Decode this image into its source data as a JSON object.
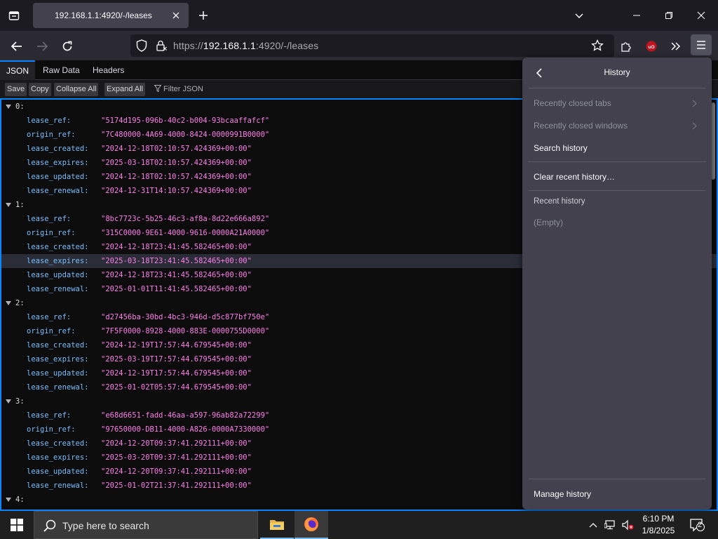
{
  "browser": {
    "tab_title": "192.168.1.1:4920/-/leases",
    "url_scheme": "https://",
    "url_host": "192.168.1.1",
    "url_rest": ":4920/-/leases"
  },
  "viewer": {
    "tabs": [
      "JSON",
      "Raw Data",
      "Headers"
    ],
    "toolbar": {
      "save": "Save",
      "copy": "Copy",
      "collapse_all": "Collapse All",
      "expand_all": "Expand All",
      "filter": "Filter JSON"
    },
    "entries": [
      {
        "index": "0:",
        "lease_ref": "\"5174d195-096b-40c2-b004-93bcaaffafcf\"",
        "origin_ref": "\"7C480000-4A69-4000-8424-0000991B0000\"",
        "lease_created": "\"2024-12-18T02:10:57.424369+00:00\"",
        "lease_expires": "\"2025-03-18T02:10:57.424369+00:00\"",
        "lease_updated": "\"2024-12-18T02:10:57.424369+00:00\"",
        "lease_renewal": "\"2024-12-31T14:10:57.424369+00:00\""
      },
      {
        "index": "1:",
        "lease_ref": "\"8bc7723c-5b25-46c3-af8a-8d22e666a892\"",
        "origin_ref": "\"315C0000-9E61-4000-9616-0000A21A0000\"",
        "lease_created": "\"2024-12-18T23:41:45.582465+00:00\"",
        "lease_expires": "\"2025-03-18T23:41:45.582465+00:00\"",
        "lease_updated": "\"2024-12-18T23:41:45.582465+00:00\"",
        "lease_renewal": "\"2025-01-01T11:41:45.582465+00:00\""
      },
      {
        "index": "2:",
        "lease_ref": "\"d27456ba-30bd-4bc3-946d-d5c877bf750e\"",
        "origin_ref": "\"7F5F0000-8928-4000-883E-0000755D0000\"",
        "lease_created": "\"2024-12-19T17:57:44.679545+00:00\"",
        "lease_expires": "\"2025-03-19T17:57:44.679545+00:00\"",
        "lease_updated": "\"2024-12-19T17:57:44.679545+00:00\"",
        "lease_renewal": "\"2025-01-02T05:57:44.679545+00:00\""
      },
      {
        "index": "3:",
        "lease_ref": "\"e68d6651-fadd-46aa-a597-96ab82a72299\"",
        "origin_ref": "\"97650000-DB11-4000-A826-0000A7330000\"",
        "lease_created": "\"2024-12-20T09:37:41.292111+00:00\"",
        "lease_expires": "\"2025-03-20T09:37:41.292111+00:00\"",
        "lease_updated": "\"2024-12-20T09:37:41.292111+00:00\"",
        "lease_renewal": "\"2025-01-02T21:37:41.292111+00:00\""
      }
    ],
    "last_index": "4:",
    "field_names": [
      "lease_ref:",
      "origin_ref:",
      "lease_created:",
      "lease_expires:",
      "lease_updated:",
      "lease_renewal:"
    ]
  },
  "history_panel": {
    "title": "History",
    "recently_closed_tabs": "Recently closed tabs",
    "recently_closed_windows": "Recently closed windows",
    "search_history": "Search history",
    "clear_recent_history": "Clear recent history…",
    "recent_history": "Recent history",
    "empty": "(Empty)",
    "manage_history": "Manage history"
  },
  "taskbar": {
    "search_placeholder": "Type here to search",
    "time": "6:10 PM",
    "date": "1/8/2025",
    "notification_count": "2"
  },
  "colors": {
    "accent": "#0a84ff",
    "json_key": "#75bfff",
    "json_string": "#ff7de9",
    "panel_bg": "#42414d"
  }
}
